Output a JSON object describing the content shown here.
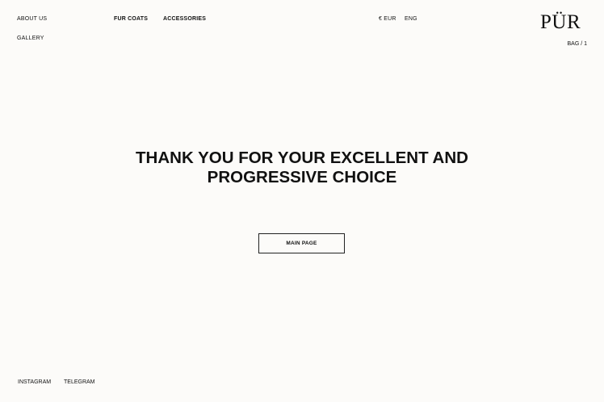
{
  "header": {
    "nav_left": {
      "about": "ABOUT US",
      "gallery": "GALLERY"
    },
    "nav_center": {
      "fur_coats": "FUR COATS",
      "accessories": "ACCESSORIES"
    },
    "currency": "€ EUR",
    "language": "ENG",
    "logo": "PÜR",
    "bag": "BAG / 1"
  },
  "main": {
    "headline_line1": "THANK YOU FOR YOUR EXCELLENT AND",
    "headline_line2": "PROGRESSIVE CHOICE",
    "button_label": "MAIN PAGE"
  },
  "footer": {
    "instagram": "INSTAGRAM",
    "telegram": "TELEGRAM"
  }
}
